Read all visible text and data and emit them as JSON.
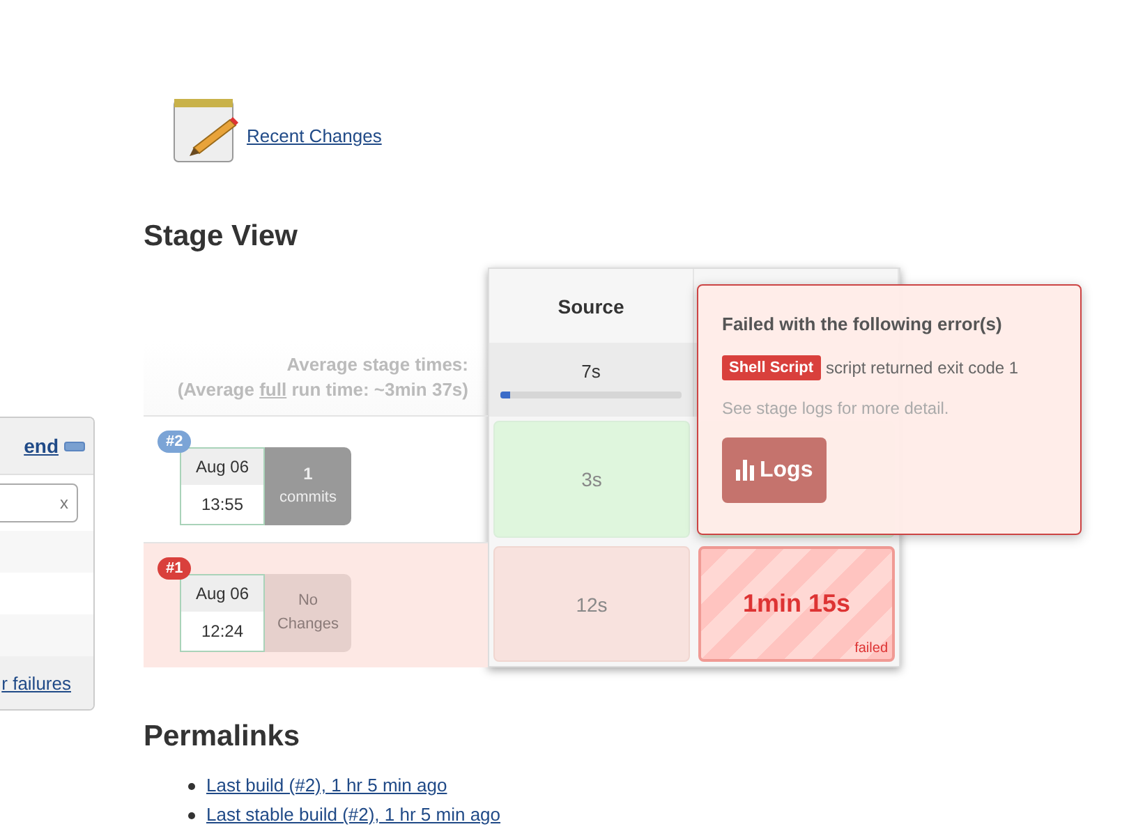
{
  "recent_changes": {
    "label": "Recent Changes"
  },
  "stage_view": {
    "title": "Stage View",
    "average_label": "Average stage times:",
    "average_prefix": "(Average ",
    "average_link": "full",
    "average_suffix": " run time: ~3min 37s)",
    "stages": [
      {
        "name": "Source",
        "average": "7s",
        "level": 0.05
      }
    ],
    "builds": [
      {
        "number": "#2",
        "failed": false,
        "date": "Aug 06",
        "time": "13:55",
        "has_changes": true,
        "changes": [
          "1",
          "commits"
        ],
        "cells": [
          {
            "failed": false,
            "duration": "3s"
          },
          {
            "failed": false
          }
        ]
      },
      {
        "number": "#1",
        "failed": true,
        "date": "Aug 06",
        "time": "12:24",
        "has_changes": false,
        "changes": [
          "No",
          "Changes"
        ],
        "cells": [
          {
            "failed": false,
            "duration": "12s"
          },
          {
            "failed": true,
            "duration": "1min 15s",
            "label": "failed"
          }
        ]
      }
    ]
  },
  "error_popup": {
    "title": "Failed with the following error(s)",
    "tag": "Shell Script",
    "message": "script returned exit code 1",
    "note": "See stage logs for more detail.",
    "button": "Logs"
  },
  "sidebar": {
    "header_link": "end",
    "clear_button": "x",
    "footer_link": "r failures"
  },
  "permalinks": {
    "title": "Permalinks",
    "items": [
      "Last build (#2), 1 hr 5 min ago",
      "Last stable build (#2), 1 hr 5 min ago"
    ]
  }
}
